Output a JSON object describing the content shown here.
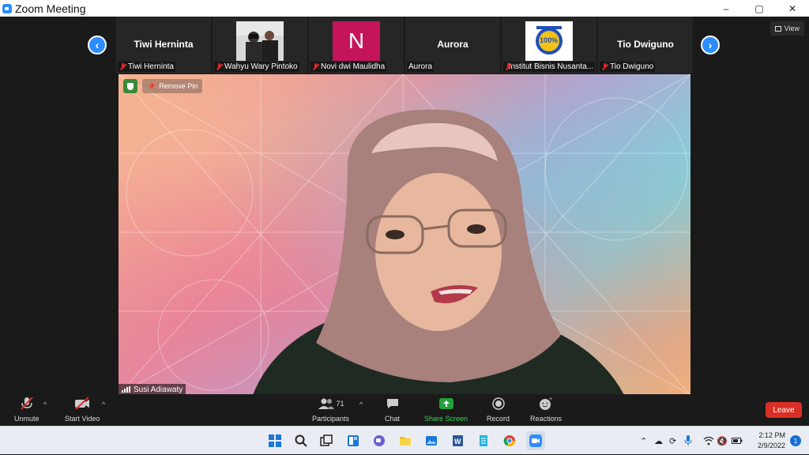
{
  "window": {
    "title": "Zoom Meeting",
    "controls": {
      "minimize": "–",
      "maximize": "▢",
      "close": "✕"
    },
    "view_label": "View"
  },
  "strip": {
    "prev_arrow": "‹",
    "next_arrow": "›",
    "tiles": [
      {
        "display_name": "Tiwi Hernita",
        "label": "Tiwi Herninta",
        "muted": true
      },
      {
        "display_name": "",
        "label": "Wahyu Wary Pintoko",
        "muted": true
      },
      {
        "display_name": "N",
        "label": "Novi dwi Maulidha",
        "muted": true
      },
      {
        "display_name": "Aurora",
        "label": "Aurora",
        "muted": false
      },
      {
        "display_name": "",
        "label": "Institut Bisnis Nusanta...",
        "muted": true
      },
      {
        "display_name": "Tio Dwiguno",
        "label": "Tio Dwiguno",
        "muted": true
      }
    ],
    "first_tile_name": "Tiwi Herninta",
    "ads_text_1": "100%"
  },
  "main": {
    "remove_pin": "Remove Pin",
    "speaker": "Susi Adiawaty"
  },
  "toolbar": {
    "unmute": "Unmute",
    "start_video": "Start Video",
    "participants": "Participants",
    "participants_count": "71",
    "chat": "Chat",
    "share_screen": "Share Screen",
    "record": "Record",
    "reactions": "Reactions",
    "leave": "Leave"
  },
  "taskbar": {
    "time": "2:12 PM",
    "date": "2/9/2022",
    "notifications": "1"
  },
  "colors": {
    "zoom_blue": "#2d8cff",
    "leave_red": "#d93025",
    "share_green": "#22a03a",
    "tile_n_bg": "#c4145a"
  }
}
